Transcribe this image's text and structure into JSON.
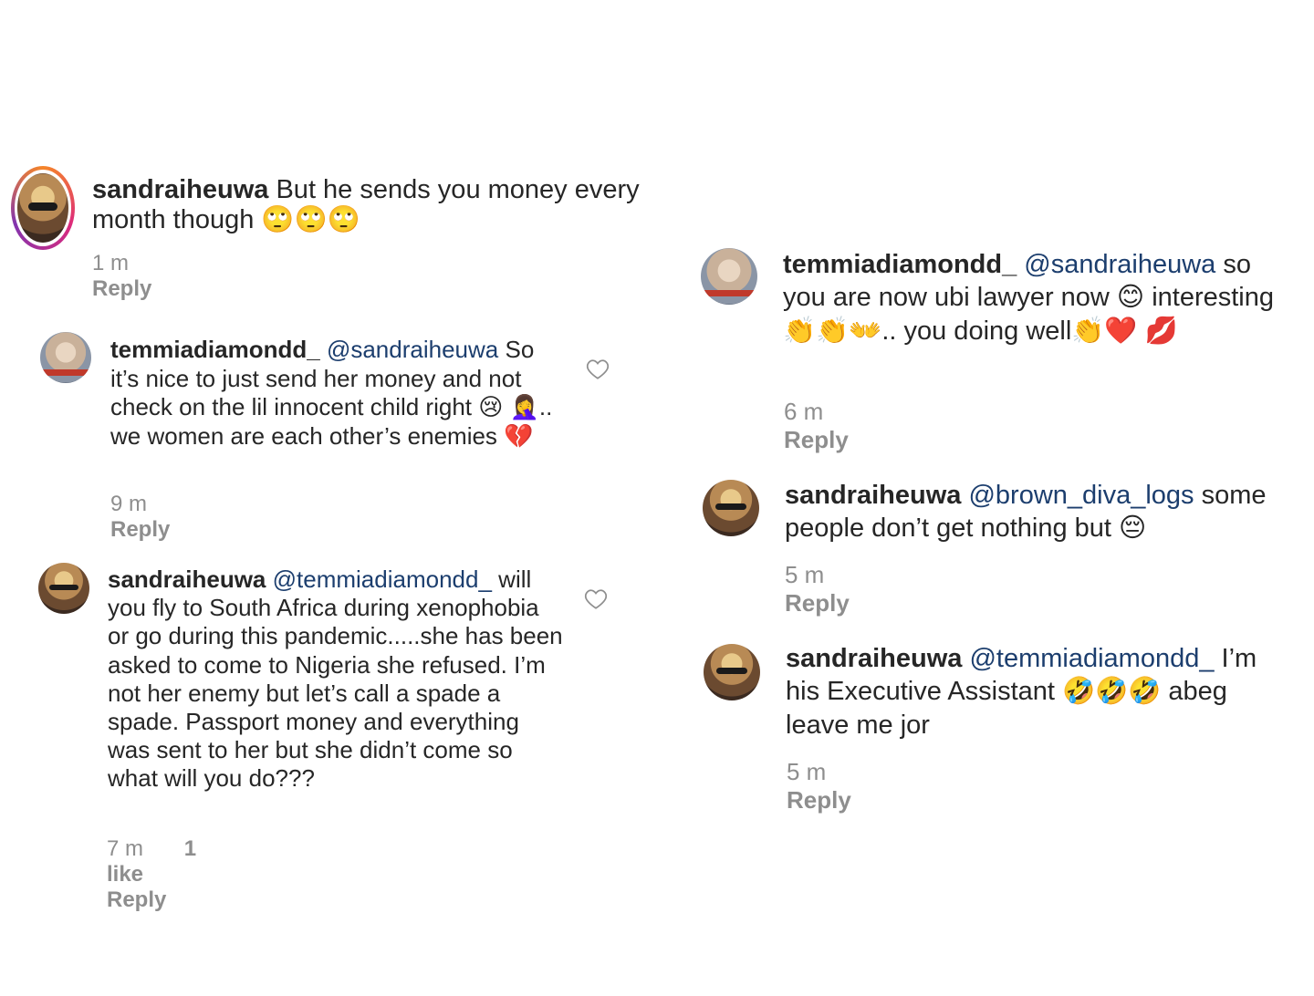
{
  "left": {
    "c1": {
      "user": "sandraiheuwa",
      "text": "But he sends you money every month though 🙄🙄🙄",
      "time": "1 m",
      "reply": "Reply"
    },
    "c2": {
      "user": "temmiadiamondd_",
      "mention": "@sandraiheuwa",
      "text": "So it’s nice to just send her money and not check on the lil innocent child right 😢 🤦‍♀️.. we women are each other’s enemies 💔",
      "time": "9 m",
      "reply": "Reply"
    },
    "c3": {
      "user": "sandraiheuwa",
      "mention": "@temmiadiamondd_",
      "text": "will you fly to  South Africa during xenophobia or go during this pandemic.....she has been asked to come to Nigeria she refused. I’m not her enemy but let’s call a spade a spade. Passport money and everything was sent to her but she didn’t come so what will you do???",
      "time": "7 m",
      "likes": "1 like",
      "reply": "Reply"
    }
  },
  "right": {
    "c4": {
      "user": "temmiadiamondd_",
      "mention": "@sandraiheuwa",
      "text": "so you are now ubi lawyer now 😊 interesting 👏👏👐.. you doing well👏❤️ 💋",
      "time": "6 m",
      "reply": "Reply"
    },
    "c5": {
      "user": "sandraiheuwa",
      "mention": "@brown_diva_logs",
      "text": "some people don’t get nothing but 😔",
      "time": "5 m",
      "reply": "Reply"
    },
    "c6": {
      "user": "sandraiheuwa",
      "mention": "@temmiadiamondd_",
      "text": "I’m his Executive Assistant 🤣🤣🤣 abeg leave me jor",
      "time": "5 m",
      "reply": "Reply"
    }
  },
  "icons": {
    "like": "heart-outline-icon"
  }
}
